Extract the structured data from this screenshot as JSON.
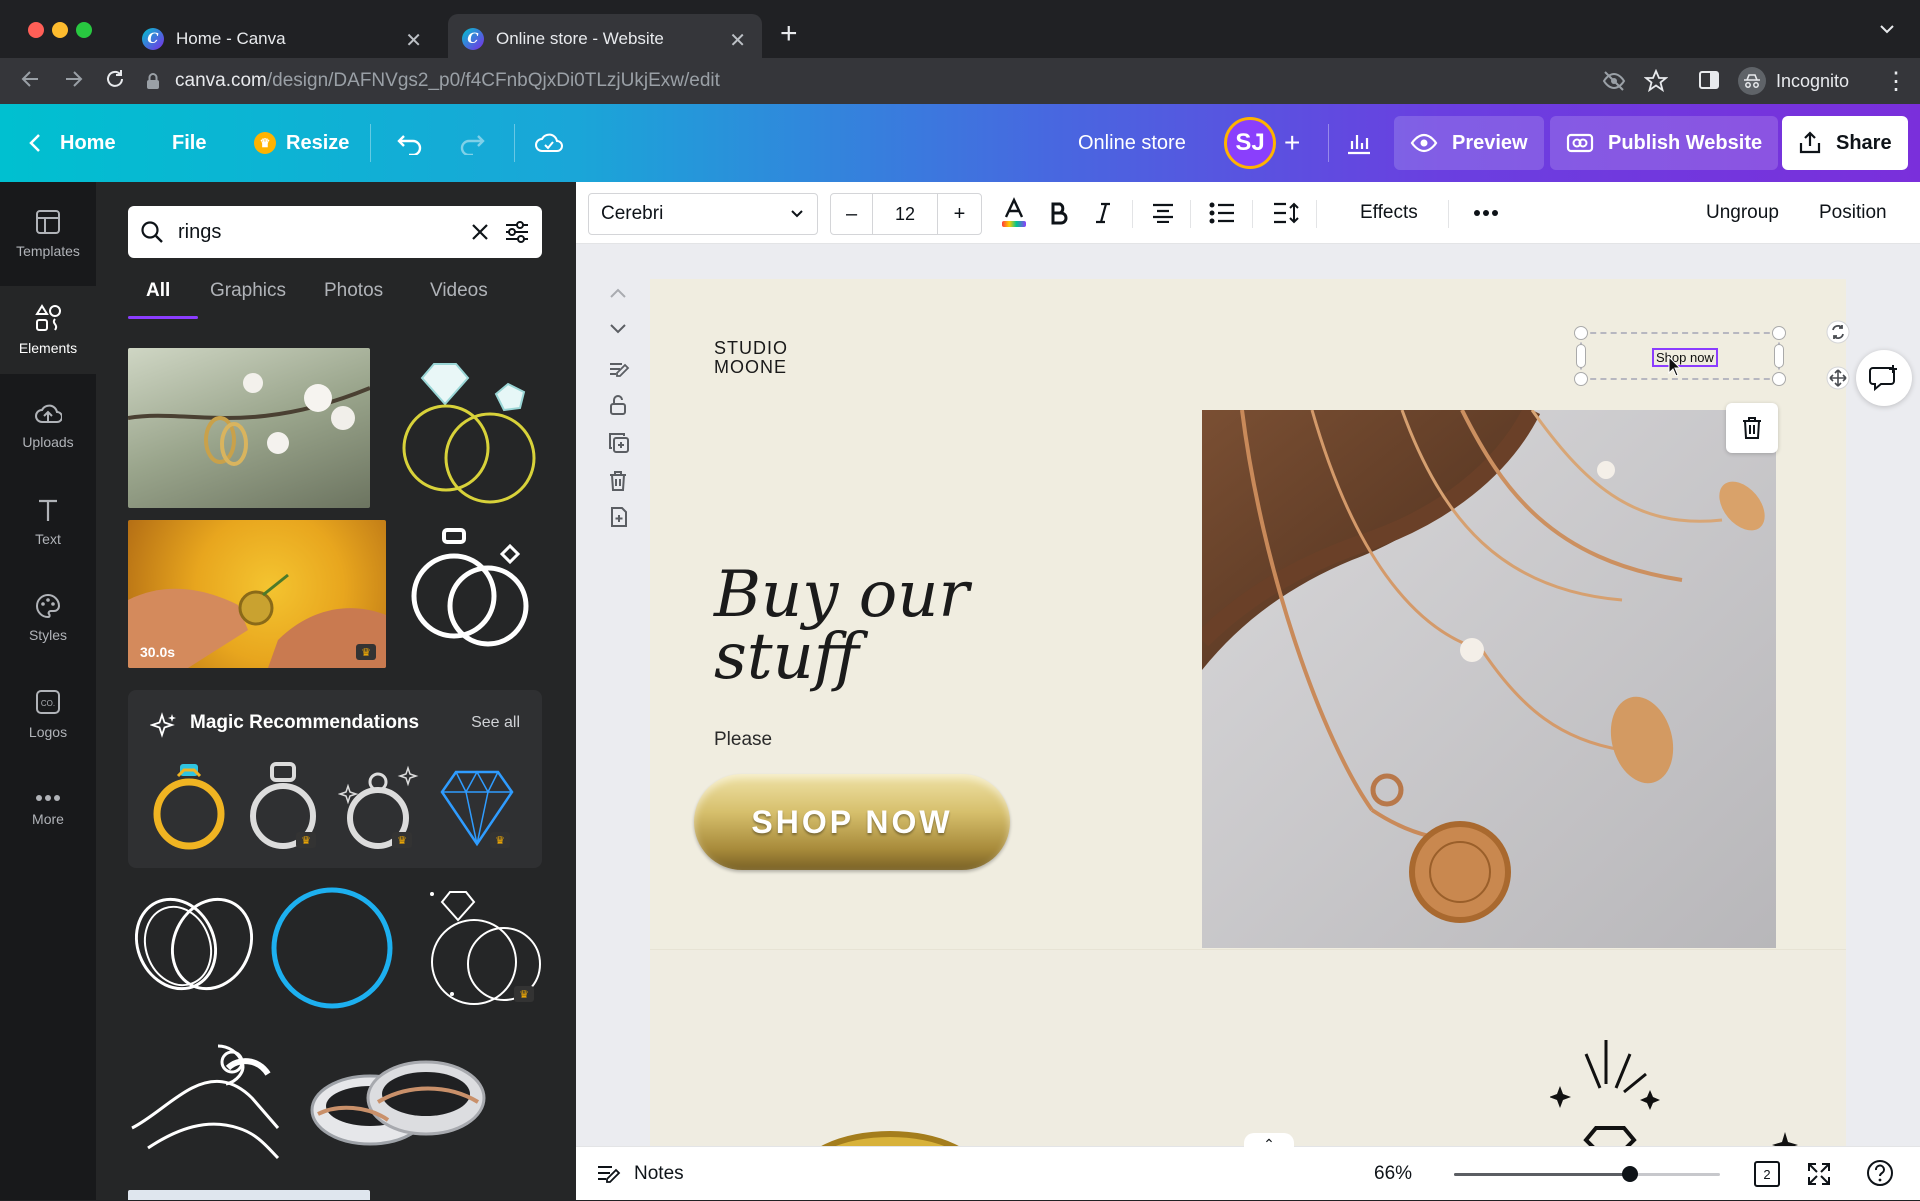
{
  "browser": {
    "tabs": [
      {
        "title": "Home - Canva",
        "active": false
      },
      {
        "title": "Online store - Website",
        "active": true
      }
    ],
    "url_host": "canva.com",
    "url_path": "/design/DAFNVgs2_p0/f4CFnbQjxDi0TLzjUkjExw/edit",
    "profile": "Incognito"
  },
  "header": {
    "home": "Home",
    "file": "File",
    "resize": "Resize",
    "design_title": "Online store",
    "avatar_initials": "SJ",
    "preview": "Preview",
    "publish": "Publish Website",
    "share": "Share"
  },
  "rail": {
    "items": [
      {
        "label": "Templates",
        "icon": "templates-icon"
      },
      {
        "label": "Elements",
        "icon": "elements-icon",
        "active": true
      },
      {
        "label": "Uploads",
        "icon": "uploads-icon"
      },
      {
        "label": "Text",
        "icon": "text-icon"
      },
      {
        "label": "Styles",
        "icon": "styles-icon"
      },
      {
        "label": "Logos",
        "icon": "logos-icon"
      },
      {
        "label": "More",
        "icon": "more-icon"
      }
    ]
  },
  "panel": {
    "search_value": "rings",
    "tabs": [
      "All",
      "Graphics",
      "Photos",
      "Videos"
    ],
    "active_tab": "All",
    "video_duration": "30.0s",
    "magic_title": "Magic Recommendations",
    "see_all": "See all"
  },
  "toolbar": {
    "font": "Cerebri",
    "font_size": "12",
    "effects": "Effects",
    "ungroup": "Ungroup",
    "position": "Position"
  },
  "canvas": {
    "logo_line1": "STUDIO",
    "logo_line2": "MOONE",
    "headline_line1": "Buy our",
    "headline_line2": "stuff",
    "subtext": "Please",
    "shop_button": "SHOP NOW",
    "selected_text": "Shop now"
  },
  "footer": {
    "notes": "Notes",
    "zoom": "66%",
    "zoom_fraction": 0.66,
    "page_count": "2"
  },
  "colors": {
    "accent": "#8b3dff",
    "page_bg": "#f0ede0",
    "panel_bg": "#252627"
  }
}
